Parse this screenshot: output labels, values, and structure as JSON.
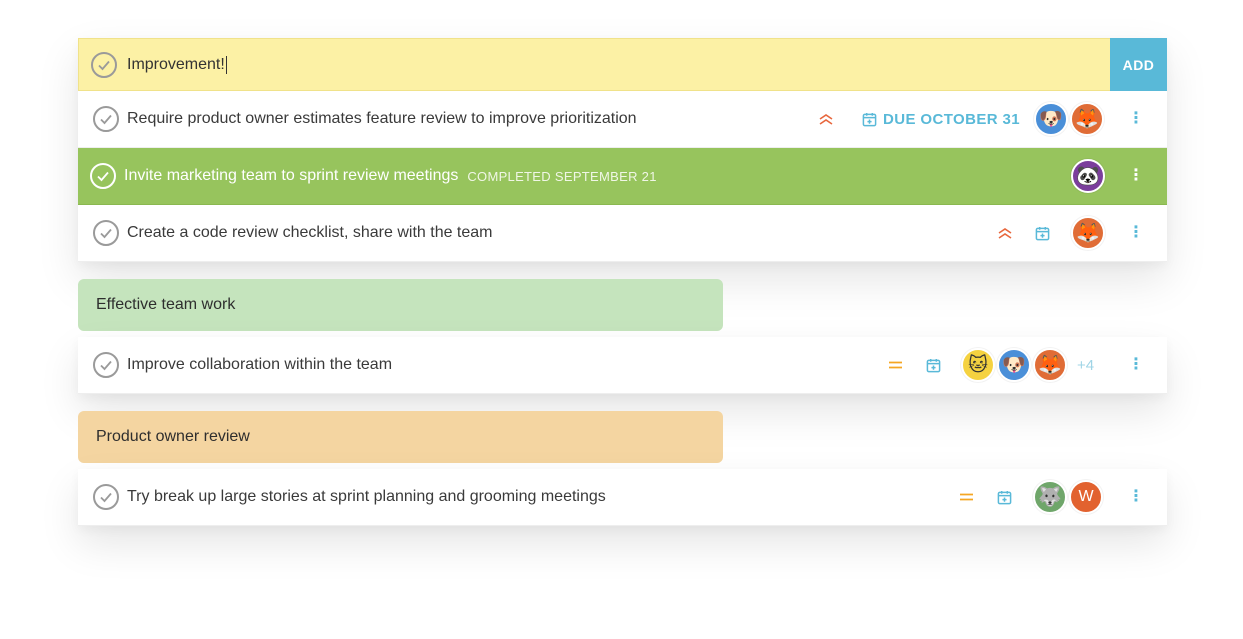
{
  "input": {
    "value": "Improvement!",
    "add_label": "ADD"
  },
  "tasks_top": [
    {
      "label": "Require product owner estimates feature review to improve prioritization",
      "priority": "high",
      "due": "DUE OCTOBER 31"
    },
    {
      "label": "Invite marketing team to sprint review meetings",
      "completed": "COMPLETED SEPTEMBER 21"
    },
    {
      "label": "Create a code review checklist, share with the team",
      "priority": "high"
    }
  ],
  "groups": [
    {
      "title": "Effective team work",
      "color": "#c5e4bd",
      "tasks": [
        {
          "label": "Improve collaboration within the team",
          "priority": "medium",
          "extra_count": "+4"
        }
      ]
    },
    {
      "title": "Product owner review",
      "color": "#f4d5a1",
      "tasks": [
        {
          "label": "Try break up large stories at sprint planning and grooming meetings",
          "priority": "medium",
          "avatar_letter": "W"
        }
      ]
    }
  ],
  "colors": {
    "accent": "#59b9d8",
    "done": "#97c45d",
    "input_bg": "#fcf1a5",
    "priority_high": "#e8673d",
    "priority_medium": "#f5a623"
  },
  "icons": {
    "check": "check-circle-icon",
    "priority_high": "double-chevron-up-icon",
    "priority_medium": "equals-icon",
    "calendar": "calendar-add-icon",
    "more": "more-vertical-icon"
  }
}
